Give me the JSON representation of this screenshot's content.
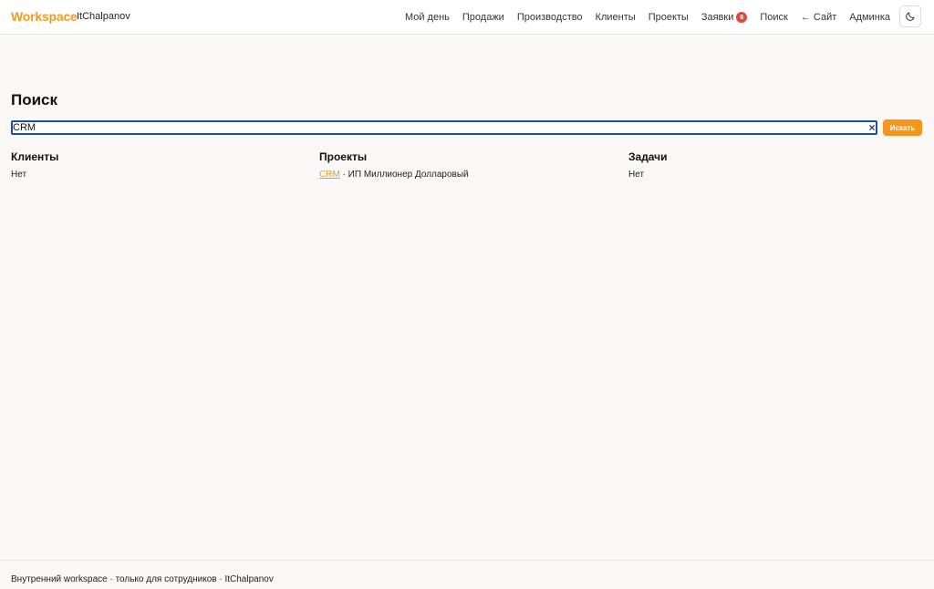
{
  "header": {
    "brand": "Workspace",
    "org": "ItChalpanov",
    "nav": [
      {
        "label": "Мой день"
      },
      {
        "label": "Продажи"
      },
      {
        "label": "Производство"
      },
      {
        "label": "Клиенты"
      },
      {
        "label": "Проекты"
      },
      {
        "label": "Заявки",
        "badge": "6"
      },
      {
        "label": "Поиск"
      },
      {
        "label": "← Сайт"
      },
      {
        "label": "Админка"
      }
    ],
    "theme_icon": "moon-icon"
  },
  "main": {
    "title": "Поиск",
    "search": {
      "value": "CRM",
      "clear": "×",
      "button": "Искать"
    },
    "columns": {
      "clients": {
        "title": "Клиенты",
        "result": "Нет"
      },
      "projects": {
        "title": "Проекты",
        "link": "CRM",
        "rest": " · ИП Миллионер Долларовый"
      },
      "tasks": {
        "title": "Задачи",
        "result": "Нет"
      }
    }
  },
  "footer": {
    "text": "Внутренний workspace · только для сотрудников · ItChalpanov"
  },
  "colors": {
    "accent": "#f29a1d",
    "focus": "#1e4e9e",
    "badge": "#e5473b"
  }
}
